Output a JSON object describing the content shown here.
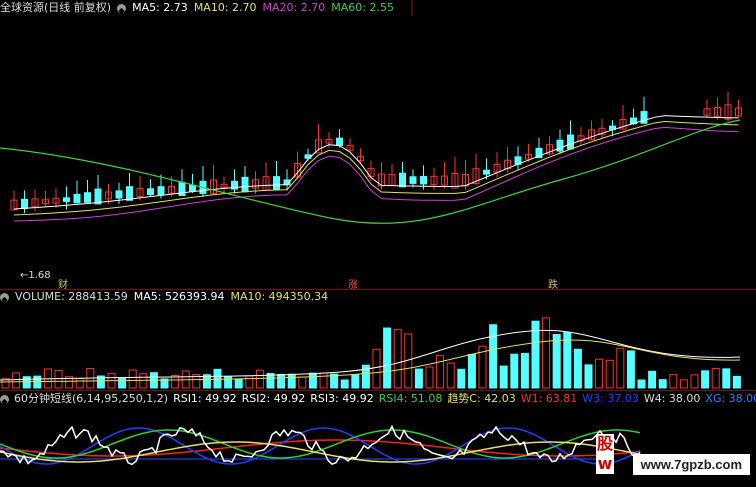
{
  "price_panel": {
    "title": "全球资源(日线 前复权)",
    "ma5": "MA5: 2.73",
    "ma10": "MA10: 2.70",
    "ma20": "MA20: 2.70",
    "ma60": "MA60: 2.55",
    "low_label": "←1.68",
    "markers": [
      "财",
      "涨",
      "跌"
    ]
  },
  "volume_panel": {
    "volume": "VOLUME: 288413.59",
    "ma5": "MA5: 526393.94",
    "ma10": "MA10: 494350.34"
  },
  "indicator_panel": {
    "title": "60分钟短线(6,14,95,250,1,2)",
    "rsi1": "RSI1: 49.92",
    "rsi2": "RSI2: 49.92",
    "rsi3": "RSI3: 49.92",
    "rsi4": "RSI4: 51.08",
    "trend": "趋势C: 42.03",
    "w1": "W1: 63.81",
    "w3": "W3: 37.03",
    "w4": "W4: 38.00",
    "xg": "XG: 38.00"
  },
  "watermark": "www.7gpzb.com",
  "badge": "股w",
  "colors": {
    "up": "#ff3030",
    "down": "#54ffff",
    "ma5": "#ffffff",
    "ma10": "#e8e060",
    "ma20": "#d040d0",
    "ma60": "#40d040",
    "separator": "#7a1010"
  }
}
